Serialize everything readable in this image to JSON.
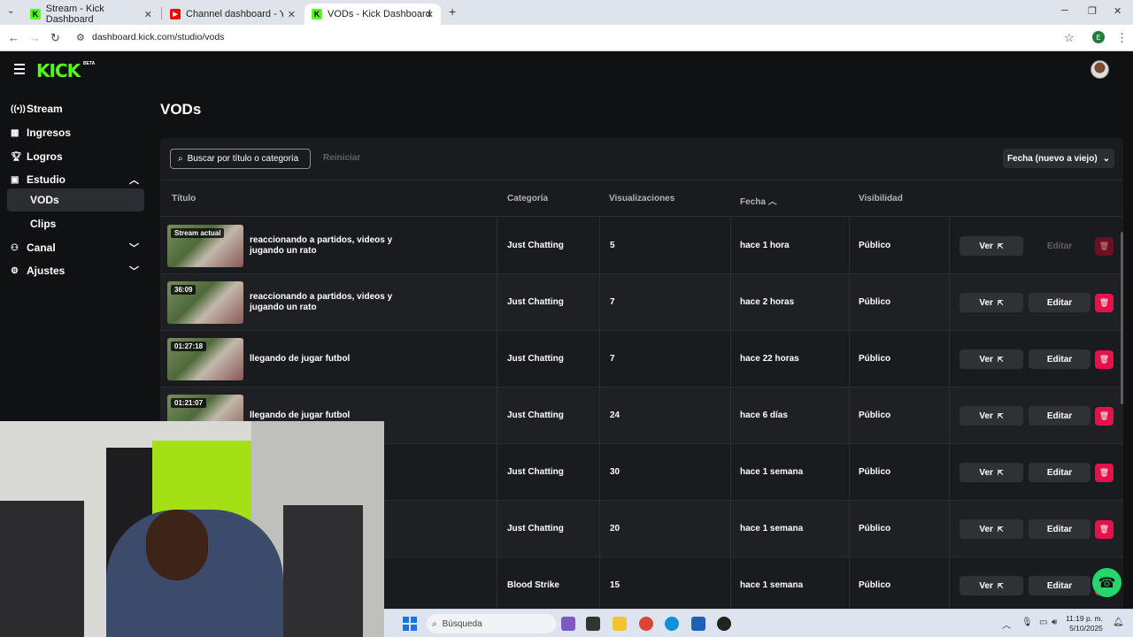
{
  "browser": {
    "tabs": [
      {
        "title": "Stream - Kick Dashboard"
      },
      {
        "title": "Channel dashboard - YouTube S"
      },
      {
        "title": "VODs - Kick Dashboard"
      }
    ],
    "url": "dashboard.kick.com/studio/vods",
    "profile_initial": "E"
  },
  "site": {
    "logo": "KICK",
    "logo_badge": "BETA",
    "sidebar": [
      {
        "label": "Stream",
        "icon": "broadcast-icon"
      },
      {
        "label": "Ingresos",
        "icon": "revenue-icon"
      },
      {
        "label": "Logros",
        "icon": "trophy-icon"
      },
      {
        "label": "Estudio",
        "icon": "studio-icon"
      },
      {
        "label": "VODs"
      },
      {
        "label": "Clips"
      },
      {
        "label": "Canal",
        "icon": "channel-icon"
      },
      {
        "label": "Ajustes",
        "icon": "gear-icon"
      }
    ],
    "page_title": "VODs",
    "search_placeholder": "Buscar por título o categoría",
    "reset_label": "Reiniciar",
    "sort_label": "Fecha (nuevo a viejo)",
    "columns": {
      "title": "Título",
      "category": "Categoría",
      "views": "Visualizaciones",
      "date": "Fecha",
      "visibility": "Visibilidad"
    },
    "view_label": "Ver",
    "edit_label": "Editar",
    "rows": [
      {
        "badge": "Stream actual",
        "title": "reaccionando a partidos, videos y jugando un rato",
        "category": "Just Chatting",
        "views": "5",
        "date": "hace 1 hora",
        "visibility": "Público",
        "editable": false
      },
      {
        "badge": "36:09",
        "title": "reaccionando a partidos, videos y jugando un rato",
        "category": "Just Chatting",
        "views": "7",
        "date": "hace 2 horas",
        "visibility": "Público",
        "editable": true
      },
      {
        "badge": "01:27:18",
        "title": "llegando de jugar futbol",
        "category": "Just Chatting",
        "views": "7",
        "date": "hace 22 horas",
        "visibility": "Público",
        "editable": true
      },
      {
        "badge": "01:21:07",
        "title": "llegando de jugar futbol",
        "category": "Just Chatting",
        "views": "24",
        "date": "hace 6 días",
        "visibility": "Público",
        "editable": true
      },
      {
        "badge": "",
        "title": "",
        "category": "Just Chatting",
        "views": "30",
        "date": "hace 1 semana",
        "visibility": "Público",
        "editable": true
      },
      {
        "badge": "",
        "title": "",
        "category": "Just Chatting",
        "views": "20",
        "date": "hace 1 semana",
        "visibility": "Público",
        "editable": true
      },
      {
        "badge": "",
        "title": "",
        "category": "Blood Strike",
        "views": "15",
        "date": "hace 1 semana",
        "visibility": "Público",
        "editable": true
      }
    ]
  },
  "taskbar": {
    "search_placeholder": "Búsqueda",
    "time": "11:19 p. m.",
    "date": "5/10/2025"
  },
  "colors": {
    "accent": "#53fc18",
    "delete": "#e6114a",
    "background": "#0f1113"
  }
}
